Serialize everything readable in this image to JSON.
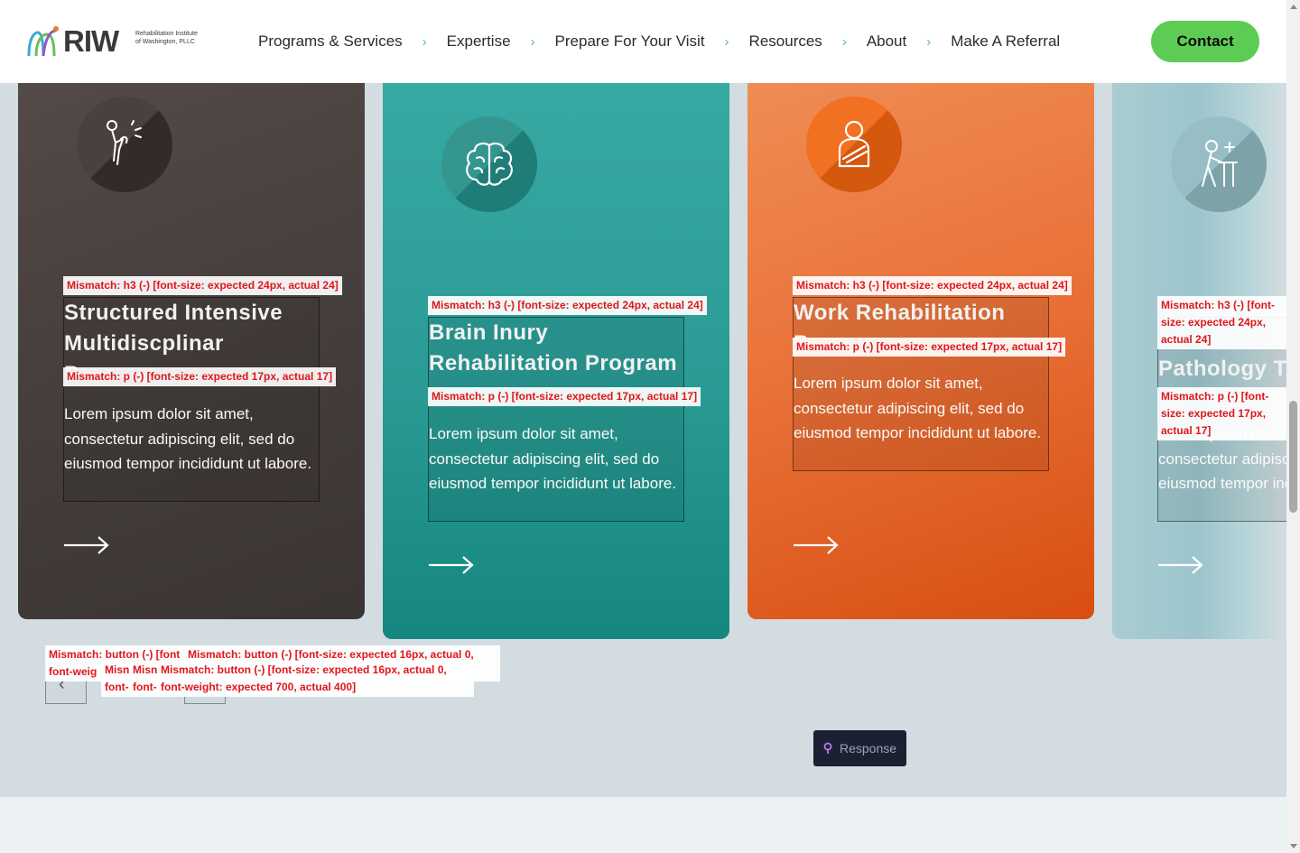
{
  "header": {
    "logo": {
      "brand": "RIW",
      "subtitle": "Rehabilitation Institute of Washington, PLLC"
    },
    "nav": [
      {
        "label": "Programs & Services"
      },
      {
        "label": "Expertise"
      },
      {
        "label": "Prepare For Your Visit"
      },
      {
        "label": "Resources"
      },
      {
        "label": "About"
      },
      {
        "label": "Make A Referral"
      }
    ],
    "contact_label": "Contact"
  },
  "cards": [
    {
      "title": "Structured Intensive Multidiscplinar Program",
      "text": "Lorem ipsum dolor sit amet, consectetur adipiscing elit, sed do eiusmod tempor incididunt ut labore.",
      "icon": "knee-pain-icon",
      "color": "#433c3a"
    },
    {
      "title": "Brain Inury Rehabilitation Program",
      "text": "Lorem ipsum dolor sit amet, consectetur adipiscing elit, sed do eiusmod tempor incididunt ut labore.",
      "icon": "brain-icon",
      "color": "#2a9b94"
    },
    {
      "title": "Work Rehabilitation Program",
      "text": "Lorem ipsum dolor sit amet, consectetur adipiscing elit, sed do eiusmod tempor incididunt ut labore.",
      "icon": "arm-sling-person-icon",
      "color": "#e9733b"
    },
    {
      "title": "Pathology Therapy",
      "text": "Lorem ipsum dolor sit amet, consectetur adipiscing elit, sed do eiusmod tempor incididunt ut labore.",
      "icon": "person-at-desk-icon",
      "color": "#9cc5cc"
    }
  ],
  "debug": {
    "h3": "Mismatch: h3 (-) [font-size: expected 24px, actual 24]",
    "p": "Mismatch: p (-) [font-size: expected 17px, actual 17]",
    "btn_a": "Mismatch: button (-) [font",
    "btn_b": "Mismatch: button (-) [font-size: expected 16px, actual 0,",
    "btn_c": "font-weig",
    "btn_d": "Misn",
    "btn_e": "Misn",
    "btn_f": "Mismatch: button (-) [font-size: expected 16px, actual 0,",
    "btn_g": "font-",
    "btn_h": "font-",
    "btn_i": "font-weight: expected 700, actual 400]"
  },
  "slider": {
    "prev_glyph": "‹",
    "next_glyph": "›"
  },
  "response_label": "Response"
}
